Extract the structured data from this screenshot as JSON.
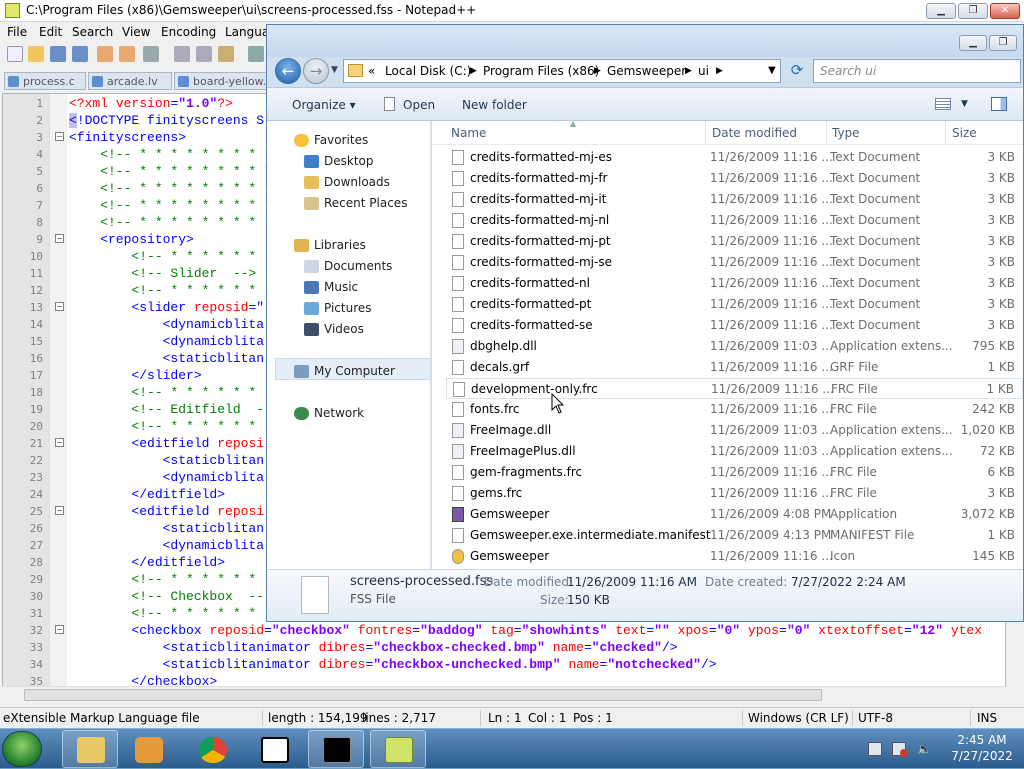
{
  "npp": {
    "title": "C:\\Program Files (x86)\\Gemsweeper\\ui\\screens-processed.fss - Notepad++",
    "menu": [
      "File",
      "Edit",
      "Search",
      "View",
      "Encoding",
      "Langua"
    ],
    "tabs": [
      "process.c",
      "arcade.lv",
      "board-yellow.fr"
    ],
    "line_numbers": [
      "1",
      "2",
      "3",
      "4",
      "5",
      "6",
      "7",
      "8",
      "9",
      "10",
      "11",
      "12",
      "13",
      "14",
      "15",
      "16",
      "17",
      "18",
      "19",
      "20",
      "21",
      "22",
      "23",
      "24",
      "25",
      "26",
      "27",
      "28",
      "29",
      "30",
      "31",
      "32",
      "33",
      "34",
      "35"
    ],
    "status": {
      "filetype": "eXtensible Markup Language file",
      "length": "length : 154,199",
      "lines": "lines : 2,717",
      "ln": "Ln : 1",
      "col": "Col : 1",
      "pos": "Pos : 1",
      "eol": "Windows (CR LF)",
      "encoding": "UTF-8",
      "mode": "INS"
    }
  },
  "explorer": {
    "breadcrumb": [
      "Local Disk (C:)",
      "Program Files (x86)",
      "Gemsweeper",
      "ui"
    ],
    "breadcrumb_prefix": "«",
    "search_placeholder": "Search ui",
    "commands": {
      "organize": "Organize ▾",
      "open": "Open",
      "new_folder": "New folder"
    },
    "nav": {
      "favorites": "Favorites",
      "desktop": "Desktop",
      "downloads": "Downloads",
      "recent": "Recent Places",
      "libraries": "Libraries",
      "documents": "Documents",
      "music": "Music",
      "pictures": "Pictures",
      "videos": "Videos",
      "computer": "My Computer",
      "network": "Network"
    },
    "columns": {
      "name": "Name",
      "date": "Date modified",
      "type": "Type",
      "size": "Size"
    },
    "files": [
      {
        "name": "credits-formatted-mj-es",
        "date": "11/26/2009 11:16 ...",
        "type": "Text Document",
        "size": "3 KB"
      },
      {
        "name": "credits-formatted-mj-fr",
        "date": "11/26/2009 11:16 ...",
        "type": "Text Document",
        "size": "3 KB"
      },
      {
        "name": "credits-formatted-mj-it",
        "date": "11/26/2009 11:16 ...",
        "type": "Text Document",
        "size": "3 KB"
      },
      {
        "name": "credits-formatted-mj-nl",
        "date": "11/26/2009 11:16 ...",
        "type": "Text Document",
        "size": "3 KB"
      },
      {
        "name": "credits-formatted-mj-pt",
        "date": "11/26/2009 11:16 ...",
        "type": "Text Document",
        "size": "3 KB"
      },
      {
        "name": "credits-formatted-mj-se",
        "date": "11/26/2009 11:16 ...",
        "type": "Text Document",
        "size": "3 KB"
      },
      {
        "name": "credits-formatted-nl",
        "date": "11/26/2009 11:16 ...",
        "type": "Text Document",
        "size": "3 KB"
      },
      {
        "name": "credits-formatted-pt",
        "date": "11/26/2009 11:16 ...",
        "type": "Text Document",
        "size": "3 KB"
      },
      {
        "name": "credits-formatted-se",
        "date": "11/26/2009 11:16 ...",
        "type": "Text Document",
        "size": "3 KB"
      },
      {
        "name": "dbghelp.dll",
        "date": "11/26/2009 11:03 ...",
        "type": "Application extens...",
        "size": "795 KB"
      },
      {
        "name": "decals.grf",
        "date": "11/26/2009 11:16 ...",
        "type": "GRF File",
        "size": "1 KB"
      },
      {
        "name": "development-only.frc",
        "date": "11/26/2009 11:16 ...",
        "type": "FRC File",
        "size": "1 KB"
      },
      {
        "name": "fonts.frc",
        "date": "11/26/2009 11:16 ...",
        "type": "FRC File",
        "size": "242 KB"
      },
      {
        "name": "FreeImage.dll",
        "date": "11/26/2009 11:03 ...",
        "type": "Application extens...",
        "size": "1,020 KB"
      },
      {
        "name": "FreeImagePlus.dll",
        "date": "11/26/2009 11:03 ...",
        "type": "Application extens...",
        "size": "72 KB"
      },
      {
        "name": "gem-fragments.frc",
        "date": "11/26/2009 11:16 ...",
        "type": "FRC File",
        "size": "6 KB"
      },
      {
        "name": "gems.frc",
        "date": "11/26/2009 11:16 ...",
        "type": "FRC File",
        "size": "3 KB"
      },
      {
        "name": "Gemsweeper",
        "date": "11/26/2009 4:08 PM",
        "type": "Application",
        "size": "3,072 KB"
      },
      {
        "name": "Gemsweeper.exe.intermediate.manifest",
        "date": "11/26/2009 4:13 PM",
        "type": "MANIFEST File",
        "size": "1 KB"
      },
      {
        "name": "Gemsweeper",
        "date": "11/26/2009 11:16 ...",
        "type": "Icon",
        "size": "145 KB"
      }
    ],
    "details": {
      "filename": "screens-processed.fss",
      "filetype": "FSS File",
      "modified_label": "Date modified:",
      "modified": "11/26/2009 11:16 AM",
      "created_label": "Date created:",
      "created": "7/27/2022 2:24 AM",
      "size_label": "Size:",
      "size": "150 KB"
    }
  },
  "taskbar": {
    "time": "2:45 AM",
    "date": "7/27/2022"
  }
}
